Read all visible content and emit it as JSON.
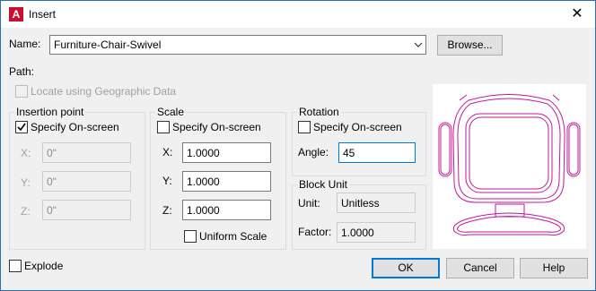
{
  "window": {
    "title": "Insert",
    "close_glyph": "✕",
    "app_icon_letter": "A"
  },
  "name": {
    "label": "Name:",
    "value": "Furniture-Chair-Swivel",
    "browse_label": "Browse..."
  },
  "path": {
    "label": "Path:"
  },
  "geo": {
    "label": "Locate using Geographic Data",
    "checked": false,
    "enabled": false
  },
  "insertion_point": {
    "title": "Insertion point",
    "specify_label": "Specify On-screen",
    "specify_checked": true,
    "x_label": "X:",
    "x_value": "0\"",
    "y_label": "Y:",
    "y_value": "0\"",
    "z_label": "Z:",
    "z_value": "0\""
  },
  "scale": {
    "title": "Scale",
    "specify_label": "Specify On-screen",
    "specify_checked": false,
    "x_label": "X:",
    "x_value": "1.0000",
    "y_label": "Y:",
    "y_value": "1.0000",
    "z_label": "Z:",
    "z_value": "1.0000",
    "uniform_label": "Uniform Scale",
    "uniform_checked": false
  },
  "rotation": {
    "title": "Rotation",
    "specify_label": "Specify On-screen",
    "specify_checked": false,
    "angle_label": "Angle:",
    "angle_value": "45"
  },
  "block_unit": {
    "title": "Block Unit",
    "unit_label": "Unit:",
    "unit_value": "Unitless",
    "factor_label": "Factor:",
    "factor_value": "1.0000"
  },
  "explode": {
    "label": "Explode",
    "checked": false
  },
  "buttons": {
    "ok": "OK",
    "cancel": "Cancel",
    "help": "Help"
  },
  "colors": {
    "accent": "#0078d7",
    "brand": "#c8102e",
    "preview_stroke": "#c0189a"
  },
  "icons": {
    "close": "close-icon",
    "dropdown": "chevron-down-icon",
    "check": "checkmark-icon"
  }
}
